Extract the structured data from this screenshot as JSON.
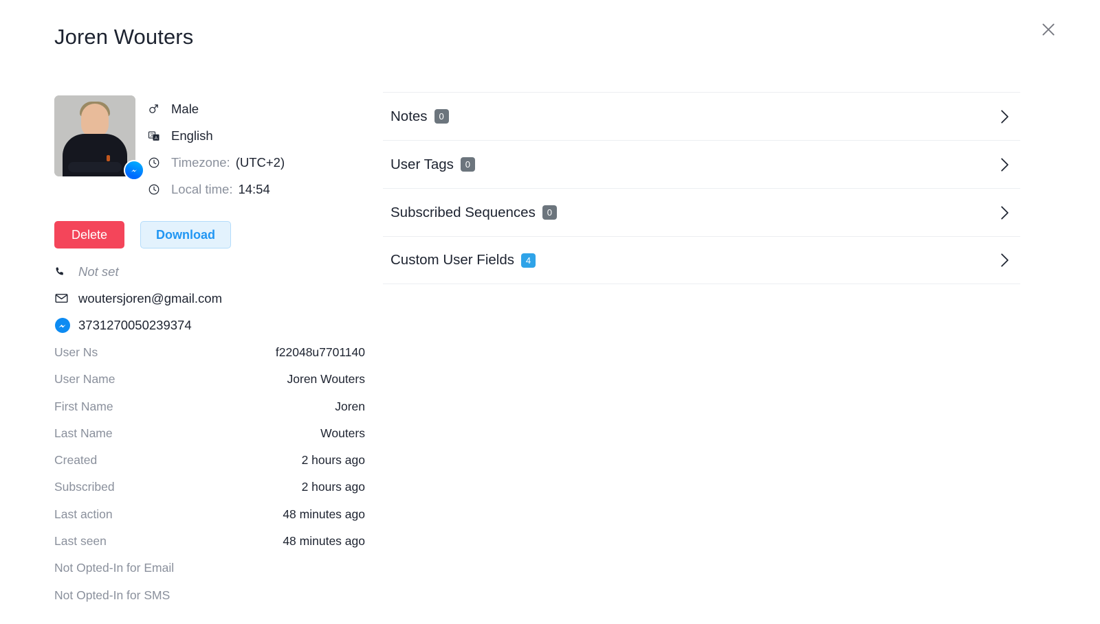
{
  "header": {
    "title": "Joren Wouters",
    "close_icon": "close-icon"
  },
  "profile": {
    "avatar_alt": "user-avatar",
    "channel_badge_icon": "messenger-icon",
    "meta": [
      {
        "icon": "gender-male-icon",
        "label": "",
        "value": "Male",
        "muted": false
      },
      {
        "icon": "language-icon",
        "label": "",
        "value": "English",
        "muted": false
      },
      {
        "icon": "clock-icon",
        "label": "Timezone:",
        "value": "(UTC+2)",
        "muted": true
      },
      {
        "icon": "clock-icon",
        "label": "Local time:",
        "value": "14:54",
        "muted": true
      }
    ],
    "buttons": {
      "delete": "Delete",
      "download": "Download"
    },
    "contacts": [
      {
        "icon": "phone-icon",
        "value": "Not set",
        "not_set": true
      },
      {
        "icon": "email-icon",
        "value": "woutersjoren@gmail.com",
        "not_set": false
      },
      {
        "icon": "messenger-icon",
        "value": "3731270050239374",
        "not_set": false
      }
    ],
    "fields": [
      {
        "label": "User Ns",
        "value": "f22048u7701140"
      },
      {
        "label": "User Name",
        "value": "Joren Wouters"
      },
      {
        "label": "First Name",
        "value": "Joren"
      },
      {
        "label": "Last Name",
        "value": "Wouters"
      },
      {
        "label": "Created",
        "value": "2 hours ago"
      },
      {
        "label": "Subscribed",
        "value": "2 hours ago"
      },
      {
        "label": "Last action",
        "value": "48 minutes ago"
      },
      {
        "label": "Last seen",
        "value": "48 minutes ago"
      },
      {
        "label": "Not Opted-In for Email",
        "value": ""
      },
      {
        "label": "Not Opted-In for SMS",
        "value": ""
      }
    ]
  },
  "sections": [
    {
      "label": "Notes",
      "count": "0",
      "accent": "gray",
      "arrow_icon": "chevron-right-icon"
    },
    {
      "label": "User Tags",
      "count": "0",
      "accent": "gray",
      "arrow_icon": "chevron-right-icon"
    },
    {
      "label": "Subscribed Sequences",
      "count": "0",
      "accent": "gray",
      "arrow_icon": "chevron-right-icon"
    },
    {
      "label": "Custom User Fields",
      "count": "4",
      "accent": "blue",
      "arrow_icon": "chevron-right-icon"
    }
  ],
  "colors": {
    "delete_bg": "#f4455a",
    "download_text": "#2196f3",
    "download_bg": "#e3f2fd",
    "badge_gray": "#6c757d",
    "badge_blue": "#2fa3e8",
    "messenger_blue": "#0084ff"
  }
}
